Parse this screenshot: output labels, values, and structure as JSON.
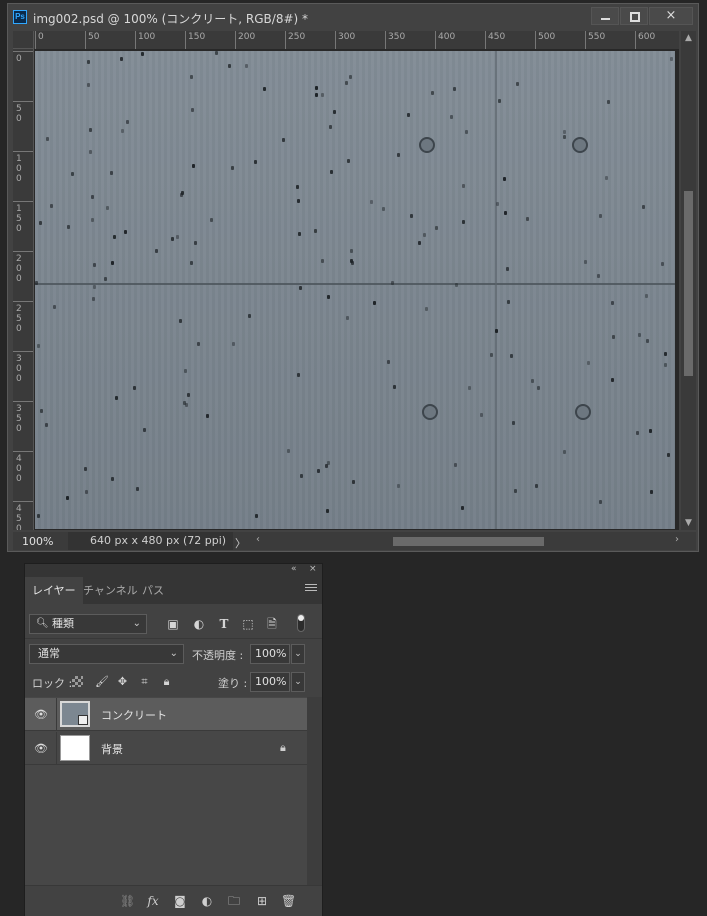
{
  "document": {
    "title": "img002.psd @ 100% (コンクリート, RGB/8#) *",
    "app_icon": "Ps",
    "window_buttons": {
      "minimize": "minimize-icon",
      "maximize": "maximize-icon",
      "close": "×"
    },
    "ruler_top": [
      "0",
      "50",
      "100",
      "150",
      "200",
      "250",
      "300",
      "350",
      "400",
      "450",
      "500",
      "550",
      "600"
    ],
    "ruler_left": [
      "0",
      "50",
      "100",
      "150",
      "200",
      "250",
      "300",
      "350",
      "400",
      "450"
    ],
    "status": {
      "zoom": "100%",
      "dimensions": "640 px x 480 px (72 ppi)",
      "arrow": "〉"
    }
  },
  "layers_panel": {
    "tabs": [
      "レイヤー",
      "チャンネル",
      "パス"
    ],
    "active_tab": 0,
    "filter": {
      "label": "種類",
      "icons": [
        "pixel-filter-icon",
        "adjustment-filter-icon",
        "type-filter-icon",
        "shape-filter-icon",
        "smart-object-filter-icon"
      ],
      "type_glyph": "T"
    },
    "blend_mode": "通常",
    "opacity_label": "不透明度 :",
    "opacity_value": "100%",
    "lock_label": "ロック :",
    "fill_label": "塗り :",
    "fill_value": "100%",
    "layers": [
      {
        "name": "コンクリート",
        "selected": true,
        "thumbnail": "concrete"
      },
      {
        "name": "背景",
        "selected": false,
        "thumbnail": "white",
        "locked": true
      }
    ],
    "footer_fx": "fx"
  }
}
